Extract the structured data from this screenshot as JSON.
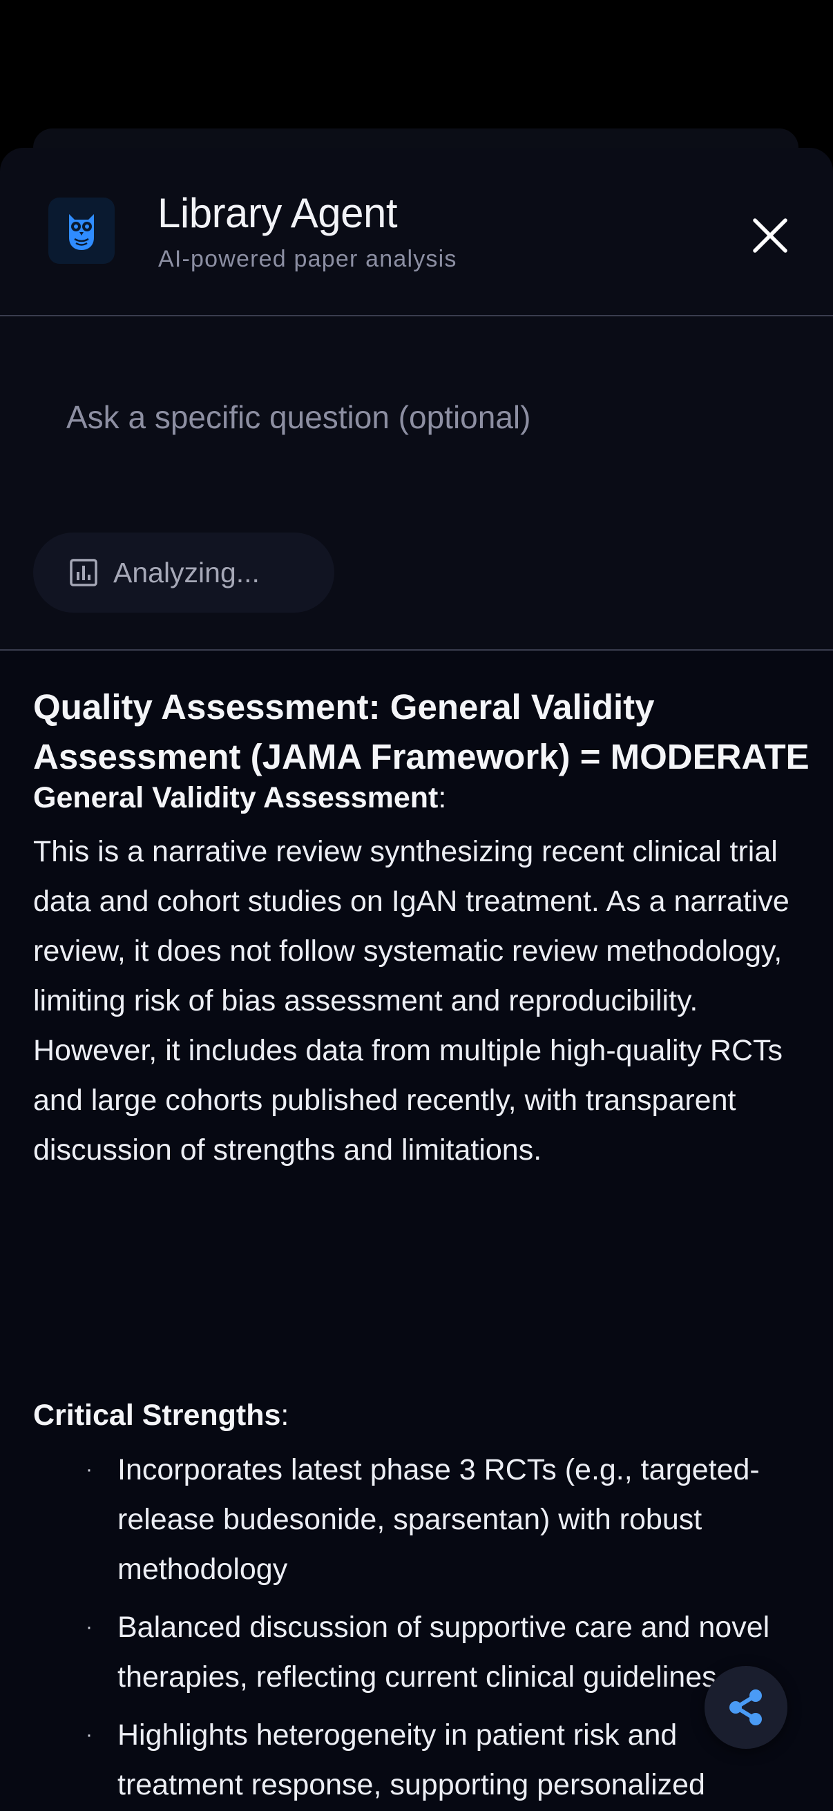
{
  "header": {
    "title": "Library Agent",
    "subtitle": "AI-powered paper analysis",
    "logo_icon": "owl-icon",
    "close_icon": "close-icon"
  },
  "input": {
    "placeholder": "Ask a specific question (optional)",
    "value": ""
  },
  "analyze_button": {
    "label": "Analyzing...",
    "icon": "bar-chart-icon"
  },
  "result": {
    "heading": "Quality Assessment: General Validity Assessment (JAMA Framework) = MODERATE",
    "validity_label": "General Validity Assessment",
    "validity_colon": ":",
    "validity_text": "This is a narrative review synthesizing recent clinical trial data and cohort studies on IgAN treatment. As a narrative review, it does not follow systematic review methodology, limiting risk of bias assessment and reproducibility. However, it includes data from multiple high-quality RCTs and large cohorts published recently, with transparent discussion of strengths and limitations.",
    "strengths_label": "Critical Strengths",
    "strengths_colon": ":",
    "bullet_char": "·",
    "strengths": [
      "Incorporates latest phase 3 RCTs (e.g., targeted-release budesonide, sparsentan) with robust methodology",
      "Balanced discussion of supportive care and novel therapies, reflecting current clinical guidelines",
      "Highlights heterogeneity in patient risk and treatment response, supporting personalized medicine"
    ]
  },
  "share_button": {
    "icon": "share-icon"
  },
  "colors": {
    "background": "#0a0c16",
    "content_background": "#060812",
    "accent_blue": "#2f8cff",
    "share_blue": "#4a9bf5",
    "text_primary": "#f4f5f8",
    "text_muted": "#8c8fa3"
  }
}
